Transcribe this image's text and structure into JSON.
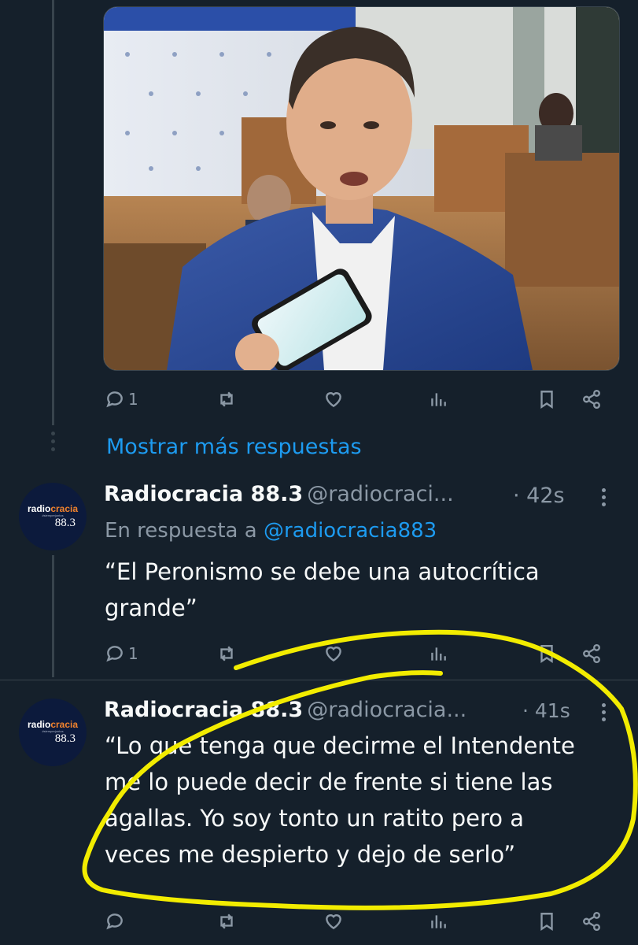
{
  "top_tweet": {
    "media": {
      "alt": "photo"
    },
    "actions": {
      "reply_count": "1",
      "retweet_count": "",
      "like_count": ""
    }
  },
  "show_more": {
    "label": "Mostrar más respuestas"
  },
  "tweets": [
    {
      "display_name": "Radiocracia 88.3",
      "handle": "@radiocraci...",
      "time": "· 42s",
      "reply_prefix": "En respuesta a",
      "reply_to": "@radiocracia883",
      "text_lines": [
        "“El Peronismo se debe una autocrítica",
        "grande”"
      ],
      "reply_count": "1"
    },
    {
      "display_name": "Radiocracia 88.3",
      "handle": "@radiocracia...",
      "time": "· 41s",
      "text_lines": [
        "“Lo que tenga que decirme el Intendente",
        "me lo puede decir de frente si tiene las",
        "agallas. Yo soy tonto un ratito pero a",
        "veces me despierto y dejo de serlo”"
      ],
      "reply_count": ""
    }
  ],
  "avatar": {
    "brand_a": "radio",
    "brand_b": "cracia",
    "freq": "88.3",
    "tagline": "#siemprejuntos"
  },
  "colors": {
    "background": "#15202b",
    "muted": "#8b98a5",
    "accent": "#1d9bf0",
    "highlight": "#f2ec00"
  }
}
